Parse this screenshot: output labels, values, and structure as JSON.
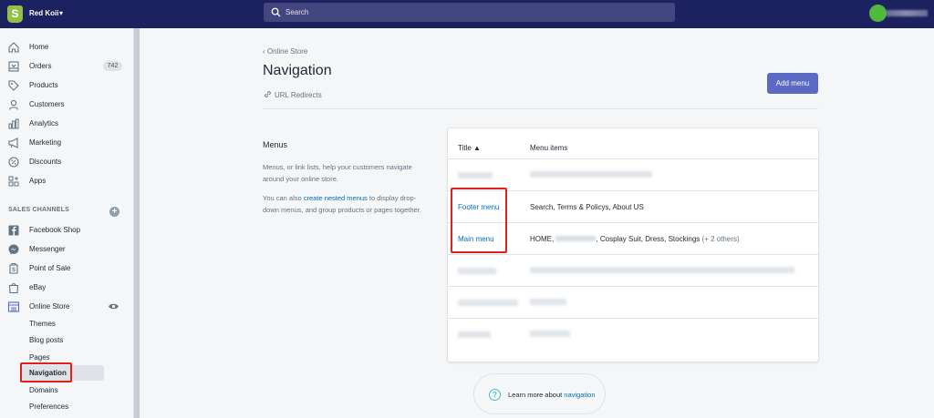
{
  "topbar": {
    "store_name": "Red Koii",
    "search_placeholder": "Search"
  },
  "sidebar": {
    "items": [
      {
        "label": "Home",
        "icon": "home-icon"
      },
      {
        "label": "Orders",
        "icon": "orders-icon",
        "badge": "742"
      },
      {
        "label": "Products",
        "icon": "tag-icon"
      },
      {
        "label": "Customers",
        "icon": "person-icon"
      },
      {
        "label": "Analytics",
        "icon": "bar-chart-icon"
      },
      {
        "label": "Marketing",
        "icon": "megaphone-icon"
      },
      {
        "label": "Discounts",
        "icon": "discount-icon"
      },
      {
        "label": "Apps",
        "icon": "apps-icon"
      }
    ],
    "sales_channels_heading": "SALES CHANNELS",
    "channels": [
      {
        "label": "Facebook Shop",
        "icon": "facebook-icon"
      },
      {
        "label": "Messenger",
        "icon": "messenger-icon"
      },
      {
        "label": "Point of Sale",
        "icon": "pos-icon"
      },
      {
        "label": "eBay",
        "icon": "shopping-bag-icon"
      },
      {
        "label": "Online Store",
        "icon": "store-icon"
      }
    ],
    "online_store_sub": [
      {
        "label": "Themes"
      },
      {
        "label": "Blog posts"
      },
      {
        "label": "Pages"
      },
      {
        "label": "Navigation",
        "active": true
      },
      {
        "label": "Domains"
      },
      {
        "label": "Preferences"
      }
    ]
  },
  "main": {
    "breadcrumb": "Online Store",
    "title": "Navigation",
    "url_redirects": "URL Redirects",
    "add_menu": "Add menu",
    "menus": {
      "title": "Menus",
      "desc1": "Menus, or link lists, help your customers navigate around your online store.",
      "desc2_before": "You can also ",
      "desc2_link": "create nested menus",
      "desc2_after": " to display drop-down menus, and group products or pages together."
    },
    "table": {
      "col_title": "Title ▲",
      "col_items": "Menu items",
      "rows": [
        {
          "title": "Footer menu",
          "items": "Search, Terms & Policys, About US"
        },
        {
          "title": "Main menu",
          "items_prefix": "HOME, ",
          "items_suffix": ", Cosplay Suit, Dress, Stockings",
          "items_more": "(+ 2 others)"
        }
      ]
    },
    "help": {
      "text": "Learn more about ",
      "link": "navigation"
    }
  },
  "colors": {
    "topbar": "#1c2260",
    "accent": "#5c6ac4",
    "link": "#006fbb",
    "highlight": "#e0201b"
  }
}
